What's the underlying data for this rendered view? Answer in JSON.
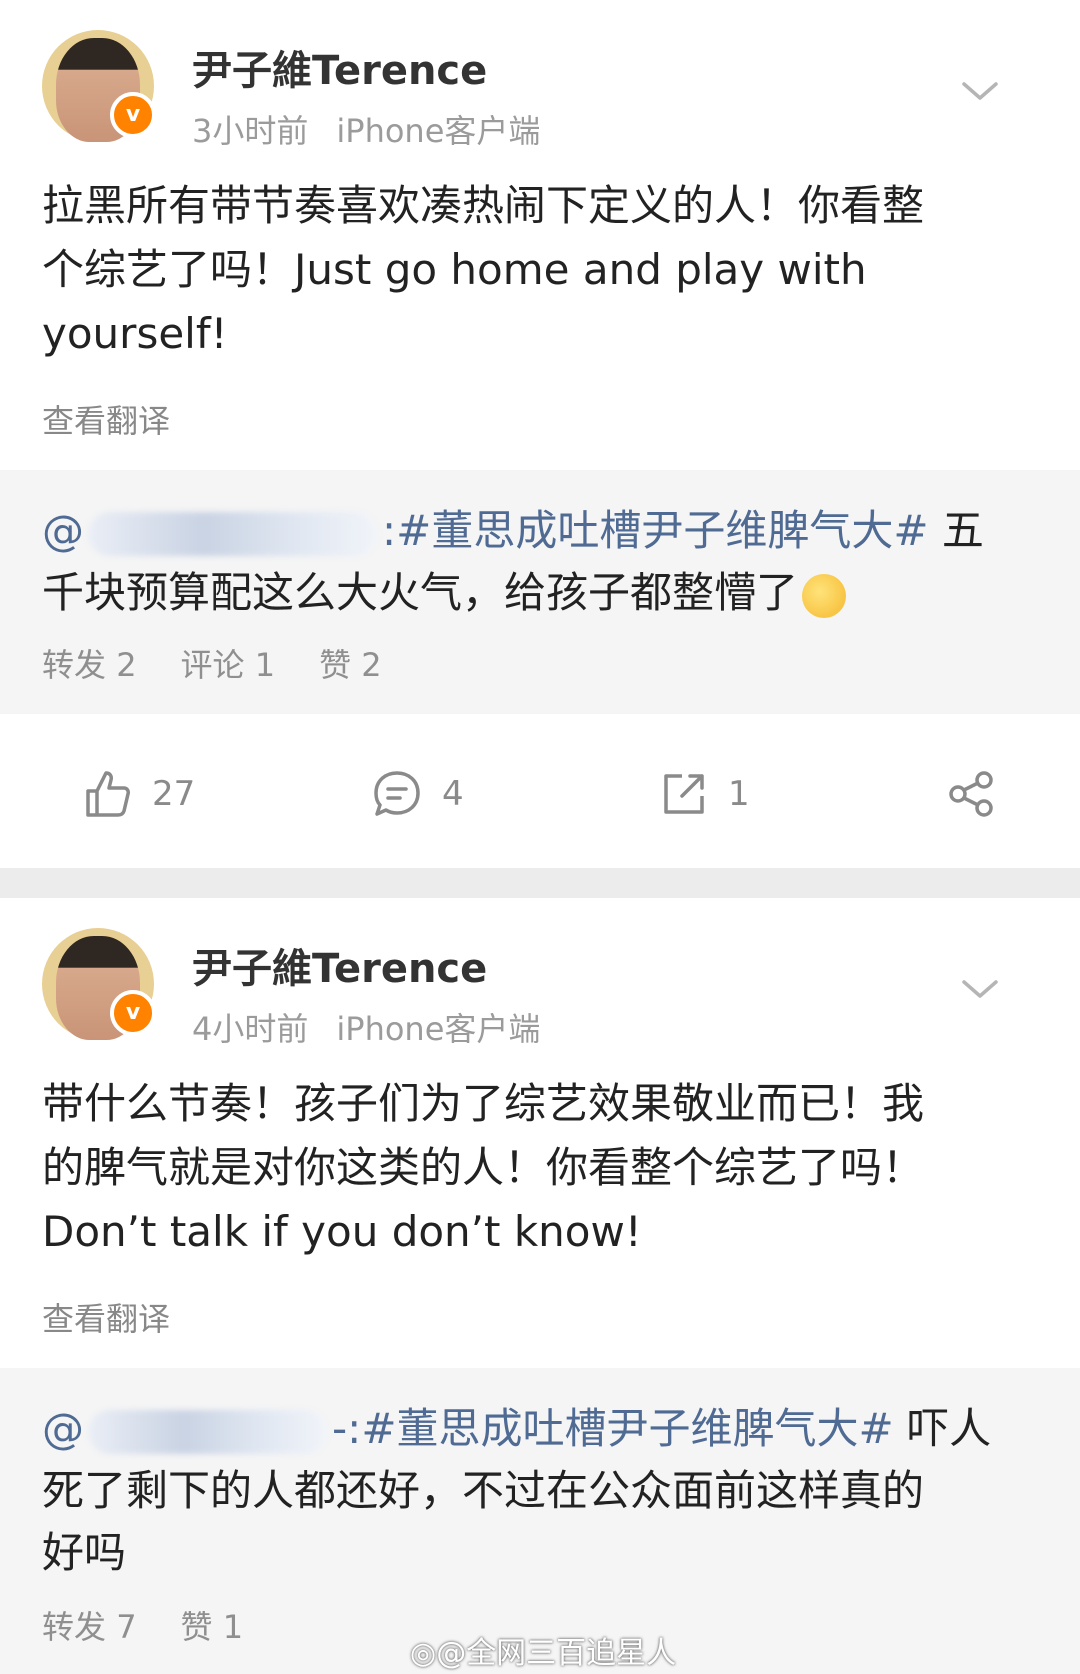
{
  "posts": [
    {
      "author": "尹子維Terence",
      "time": "3小时前",
      "client": "iPhone客户端",
      "text_lines": [
        "拉黑所有带节奏喜欢凑热闹下定义的人！你看整",
        "个综艺了吗！Just go home and play with",
        "yourself!"
      ],
      "translate": "查看翻译",
      "repost": {
        "mention_prefix": "@",
        "mention_tail": ":",
        "hashtag": "#董思成吐槽尹子维脾气大#",
        "text_after": "五",
        "line2": "千块预算配这么大火气，给孩子都整懵了",
        "stats": [
          {
            "label": "转发",
            "count": "2"
          },
          {
            "label": "评论",
            "count": "1"
          },
          {
            "label": "赞",
            "count": "2"
          }
        ]
      },
      "actions": {
        "like": "27",
        "comment": "4",
        "repost": "1"
      }
    },
    {
      "author": "尹子維Terence",
      "time": "4小时前",
      "client": "iPhone客户端",
      "text_lines": [
        "带什么节奏！孩子们为了综艺效果敬业而已！我",
        "的脾气就是对你这类的人！你看整个综艺了吗！",
        "Don’t talk if you don’t know!"
      ],
      "translate": "查看翻译",
      "repost": {
        "mention_prefix": "@",
        "mention_tail": "-:",
        "hashtag": "#董思成吐槽尹子维脾气大#",
        "text_after": "吓人",
        "line2": "死了剩下的人都还好，不过在公众面前这样真的",
        "line3": "好吗",
        "stats": [
          {
            "label": "转发",
            "count": "7"
          },
          {
            "label": "赞",
            "count": "1"
          }
        ]
      }
    }
  ],
  "watermark": "@全网三百追星人",
  "colors": {
    "link": "#506b93",
    "verified": "#ff8200"
  }
}
